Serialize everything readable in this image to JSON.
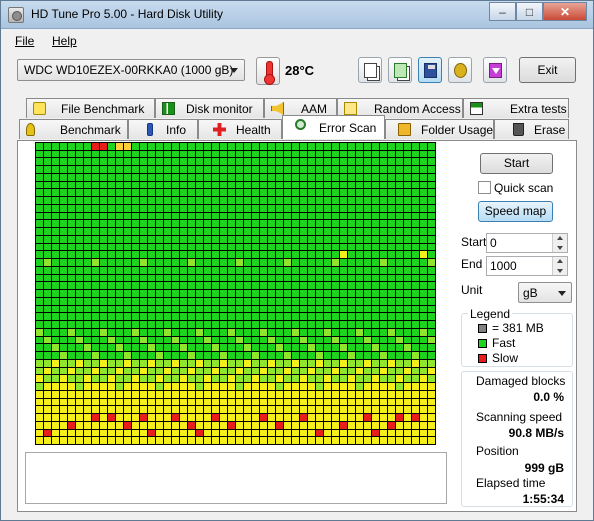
{
  "window": {
    "title": "HD Tune Pro 5.00 - Hard Disk Utility",
    "controls": {
      "minimize": "–",
      "maximize": "□",
      "close": "✕"
    }
  },
  "menu": {
    "file": "File",
    "help": "Help"
  },
  "toolbar": {
    "drive": "WDC WD10EZEX-00RKKA0   (1000 gB)",
    "temperature": "28°C",
    "exit_label": "Exit",
    "icons": [
      "copy-text-icon",
      "copy-screenshot-icon",
      "save-icon",
      "options-icon",
      "download-icon"
    ]
  },
  "tabs": {
    "row1": [
      "File Benchmark",
      "Disk monitor",
      "AAM",
      "Random Access",
      "Extra tests"
    ],
    "row2": [
      "Benchmark",
      "Info",
      "Health",
      "Error Scan",
      "Folder Usage",
      "Erase"
    ],
    "active": "Error Scan"
  },
  "controls": {
    "start_button": "Start",
    "quick_scan_label": "Quick scan",
    "quick_scan_checked": false,
    "speed_map_button": "Speed map",
    "start_label": "Start",
    "start_value": "0",
    "end_label": "End",
    "end_value": "1000",
    "unit_label": "Unit",
    "unit_value": "gB"
  },
  "legend": {
    "title": "Legend",
    "items": [
      {
        "label": "= 381 MB",
        "color": "#808080"
      },
      {
        "label": "Fast",
        "color": "#1ed31e"
      },
      {
        "label": "Slow",
        "color": "#ea1d1d"
      }
    ]
  },
  "stats": {
    "damaged_blocks_label": "Damaged blocks",
    "damaged_blocks_value": "0.0 %",
    "scanning_speed_label": "Scanning speed",
    "scanning_speed_value": "90.8 MB/s",
    "position_label": "Position",
    "position_value": "999 gB",
    "elapsed_time_label": "Elapsed time",
    "elapsed_time_value": "1:55:34"
  },
  "scan_map": {
    "columns": 50,
    "rows": 39,
    "colors": {
      "green": "#1ed31e",
      "lightgreen": "#8fe62d",
      "yellow": "#f4ee1d",
      "orange": "#ffcf3a",
      "red": "#ea1d1d"
    }
  }
}
